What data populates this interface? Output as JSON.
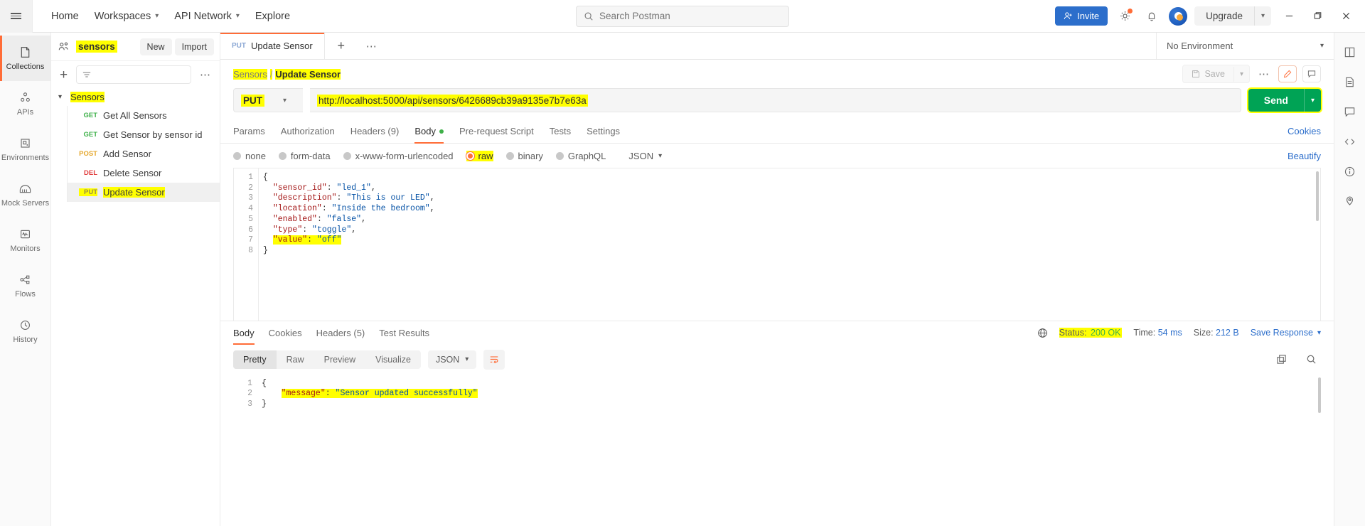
{
  "topbar": {
    "nav": [
      {
        "label": "Home",
        "caret": false
      },
      {
        "label": "Workspaces",
        "caret": true
      },
      {
        "label": "API Network",
        "caret": true
      },
      {
        "label": "Explore",
        "caret": false
      }
    ],
    "search_placeholder": "Search Postman",
    "invite_label": "Invite",
    "upgrade_label": "Upgrade",
    "icons": {
      "hamburger": "hamburger-icon",
      "search": "search-icon",
      "settings": "gear-icon",
      "notifications": "bell-icon",
      "avatar": "user-avatar",
      "minimize": "minimize-icon",
      "maximize": "restore-icon",
      "close": "close-icon"
    }
  },
  "rail": {
    "items": [
      {
        "label": "Collections",
        "icon": "collections-icon",
        "active": true
      },
      {
        "label": "APIs",
        "icon": "apis-icon",
        "active": false
      },
      {
        "label": "Environments",
        "icon": "environments-icon",
        "active": false
      },
      {
        "label": "Mock Servers",
        "icon": "mock-servers-icon",
        "active": false
      },
      {
        "label": "Monitors",
        "icon": "monitors-icon",
        "active": false
      },
      {
        "label": "Flows",
        "icon": "flows-icon",
        "active": false
      },
      {
        "label": "History",
        "icon": "history-icon",
        "active": false
      }
    ]
  },
  "sidebar": {
    "workspace_name": "sensors",
    "new_label": "New",
    "import_label": "Import",
    "filter_placeholder": "",
    "collection": {
      "name": "Sensors",
      "expanded": true,
      "requests": [
        {
          "method": "GET",
          "name": "Get All Sensors",
          "selected": false
        },
        {
          "method": "GET",
          "name": "Get Sensor by sensor id",
          "selected": false
        },
        {
          "method": "POST",
          "name": "Add Sensor",
          "selected": false
        },
        {
          "method": "DEL",
          "name": "Delete Sensor",
          "selected": false
        },
        {
          "method": "PUT",
          "name": "Update Sensor",
          "selected": true
        }
      ]
    }
  },
  "tabstrip": {
    "tabs": [
      {
        "method": "PUT",
        "title": "Update Sensor",
        "active": true
      }
    ],
    "environment": "No Environment"
  },
  "breadcrumb": {
    "collection": "Sensors",
    "separator": "/",
    "request": "Update Sensor",
    "save_label": "Save"
  },
  "request": {
    "method": "PUT",
    "url": "http://localhost:5000/api/sensors/6426689cb39a9135e7b7e63a",
    "send_label": "Send",
    "tabs": [
      {
        "label": "Params",
        "active": false,
        "dot": false,
        "count": null
      },
      {
        "label": "Authorization",
        "active": false,
        "dot": false,
        "count": null
      },
      {
        "label": "Headers (9)",
        "active": false,
        "dot": false,
        "count": null
      },
      {
        "label": "Body",
        "active": true,
        "dot": true,
        "count": null
      },
      {
        "label": "Pre-request Script",
        "active": false,
        "dot": false,
        "count": null
      },
      {
        "label": "Tests",
        "active": false,
        "dot": false,
        "count": null
      },
      {
        "label": "Settings",
        "active": false,
        "dot": false,
        "count": null
      }
    ],
    "cookies_label": "Cookies",
    "body_modes": [
      {
        "label": "none",
        "selected": false
      },
      {
        "label": "form-data",
        "selected": false
      },
      {
        "label": "x-www-form-urlencoded",
        "selected": false
      },
      {
        "label": "raw",
        "selected": true
      },
      {
        "label": "binary",
        "selected": false
      },
      {
        "label": "GraphQL",
        "selected": false
      }
    ],
    "raw_format": "JSON",
    "beautify_label": "Beautify",
    "body_lines": [
      {
        "n": "1",
        "tokens": [
          {
            "t": "{",
            "c": "p"
          }
        ]
      },
      {
        "n": "2",
        "tokens": [
          {
            "t": "  ",
            "c": "dotspc"
          },
          {
            "t": "\"sensor_id\"",
            "c": "k"
          },
          {
            "t": ": ",
            "c": "p"
          },
          {
            "t": "\"led_1\"",
            "c": "s"
          },
          {
            "t": ",",
            "c": "p"
          }
        ]
      },
      {
        "n": "3",
        "tokens": [
          {
            "t": "  ",
            "c": "dotspc"
          },
          {
            "t": "\"description\"",
            "c": "k"
          },
          {
            "t": ": ",
            "c": "p"
          },
          {
            "t": "\"This is our LED\"",
            "c": "s"
          },
          {
            "t": ",",
            "c": "p"
          }
        ]
      },
      {
        "n": "4",
        "tokens": [
          {
            "t": "  ",
            "c": "dotspc"
          },
          {
            "t": "\"location\"",
            "c": "k"
          },
          {
            "t": ": ",
            "c": "p"
          },
          {
            "t": "\"Inside the bedroom\"",
            "c": "s"
          },
          {
            "t": ",",
            "c": "p"
          }
        ]
      },
      {
        "n": "5",
        "tokens": [
          {
            "t": "  ",
            "c": "dotspc"
          },
          {
            "t": "\"enabled\"",
            "c": "k"
          },
          {
            "t": ": ",
            "c": "p"
          },
          {
            "t": "\"false\"",
            "c": "s"
          },
          {
            "t": ",",
            "c": "p"
          }
        ]
      },
      {
        "n": "6",
        "tokens": [
          {
            "t": "  ",
            "c": "dotspc"
          },
          {
            "t": "\"type\"",
            "c": "k"
          },
          {
            "t": ": ",
            "c": "p"
          },
          {
            "t": "\"toggle\"",
            "c": "s"
          },
          {
            "t": ",",
            "c": "p"
          }
        ]
      },
      {
        "n": "7",
        "tokens": [
          {
            "t": "  ",
            "c": "dotspc"
          },
          {
            "t": "\"value\"",
            "c": "k"
          },
          {
            "t": ": ",
            "c": "p"
          },
          {
            "t": "\"off\"",
            "c": "s"
          }
        ],
        "highlight": true
      },
      {
        "n": "8",
        "tokens": [
          {
            "t": "}",
            "c": "p"
          }
        ]
      }
    ]
  },
  "response": {
    "tabs": [
      {
        "label": "Body",
        "active": true
      },
      {
        "label": "Cookies",
        "active": false
      },
      {
        "label": "Headers (5)",
        "active": false
      },
      {
        "label": "Test Results",
        "active": false
      }
    ],
    "status_label": "Status:",
    "status_value": "200 OK",
    "time_label": "Time:",
    "time_value": "54 ms",
    "size_label": "Size:",
    "size_value": "212 B",
    "save_response_label": "Save Response",
    "view_modes": [
      {
        "label": "Pretty",
        "active": true
      },
      {
        "label": "Raw",
        "active": false
      },
      {
        "label": "Preview",
        "active": false
      },
      {
        "label": "Visualize",
        "active": false
      }
    ],
    "format": "JSON",
    "body_lines": [
      {
        "n": "1",
        "tokens": [
          {
            "t": "{",
            "c": "p"
          }
        ]
      },
      {
        "n": "2",
        "tokens": [
          {
            "t": "    ",
            "c": "dotspc"
          },
          {
            "t": "\"message\"",
            "c": "k"
          },
          {
            "t": ": ",
            "c": "p"
          },
          {
            "t": "\"Sensor updated successfully\"",
            "c": "s"
          }
        ],
        "highlight": true
      },
      {
        "n": "3",
        "tokens": [
          {
            "t": "}",
            "c": "p"
          }
        ]
      }
    ]
  },
  "right_rail": {
    "items": [
      "layout-icon",
      "documentation-icon",
      "comments-icon",
      "code-icon",
      "info-icon",
      "location-icon"
    ]
  }
}
